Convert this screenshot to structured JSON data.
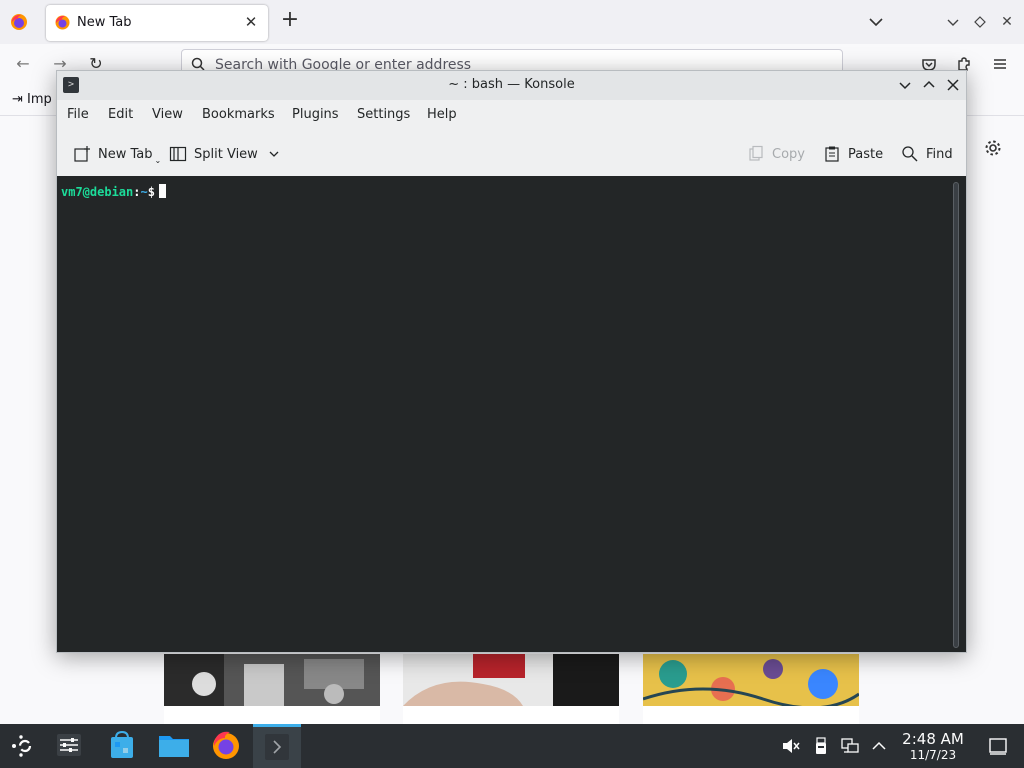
{
  "firefox": {
    "tab": {
      "title": "New Tab"
    },
    "urlbar": {
      "placeholder": "Search with Google or enter address"
    },
    "bookmarks": {
      "import_label": "Imp"
    }
  },
  "konsole": {
    "title": "~ : bash — Konsole",
    "menu": [
      "File",
      "Edit",
      "View",
      "Bookmarks",
      "Plugins",
      "Settings",
      "Help"
    ],
    "toolbar": {
      "new_tab": "New Tab",
      "split_view": "Split View",
      "copy": "Copy",
      "paste": "Paste",
      "find": "Find"
    },
    "terminal": {
      "user_host": "vm7@debian",
      "separator": ":",
      "path": "~",
      "symbol": "$"
    }
  },
  "taskbar": {
    "time": "2:48 AM",
    "date": "11/7/23"
  },
  "colors": {
    "terminal_bg": "#232627",
    "prompt_user": "#1cdc9a",
    "prompt_path": "#3daee9",
    "taskbar_bg": "#2a2e32",
    "accent": "#3daee9"
  }
}
